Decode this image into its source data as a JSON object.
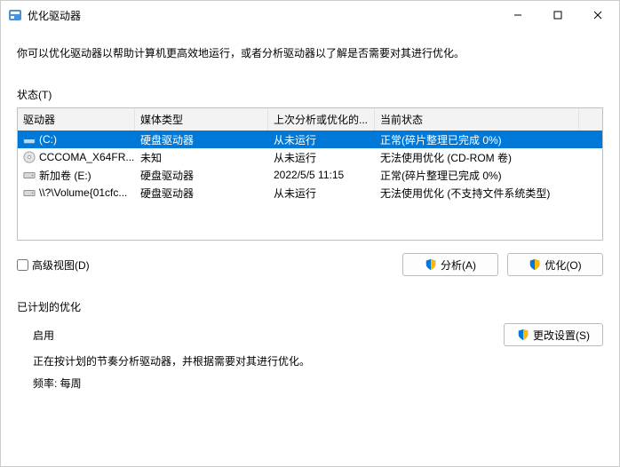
{
  "window": {
    "title": "优化驱动器"
  },
  "intro": "你可以优化驱动器以帮助计算机更高效地运行，或者分析驱动器以了解是否需要对其进行优化。",
  "status_label": "状态(T)",
  "columns": {
    "drive": "驱动器",
    "media": "媒体类型",
    "last": "上次分析或优化的...",
    "status": "当前状态"
  },
  "rows": [
    {
      "drive": "(C:)",
      "media": "硬盘驱动器",
      "last": "从未运行",
      "status": "正常(碎片整理已完成 0%)",
      "selected": true,
      "icon": "os"
    },
    {
      "drive": "CCCOMA_X64FR...",
      "media": "未知",
      "last": "从未运行",
      "status": "无法使用优化 (CD-ROM 卷)",
      "selected": false,
      "icon": "cd"
    },
    {
      "drive": "新加卷 (E:)",
      "media": "硬盘驱动器",
      "last": "2022/5/5 11:15",
      "status": "正常(碎片整理已完成 0%)",
      "selected": false,
      "icon": "hdd"
    },
    {
      "drive": "\\\\?\\Volume{01cfc...",
      "media": "硬盘驱动器",
      "last": "从未运行",
      "status": "无法使用优化 (不支持文件系统类型)",
      "selected": false,
      "icon": "hdd"
    }
  ],
  "advanced_view": "高级视图(D)",
  "buttons": {
    "analyze": "分析(A)",
    "optimize": "优化(O)",
    "change": "更改设置(S)"
  },
  "sched": {
    "title": "已计划的优化",
    "state": "启用",
    "desc": "正在按计划的节奏分析驱动器，并根据需要对其进行优化。",
    "freq_label": "频率: 每周"
  }
}
